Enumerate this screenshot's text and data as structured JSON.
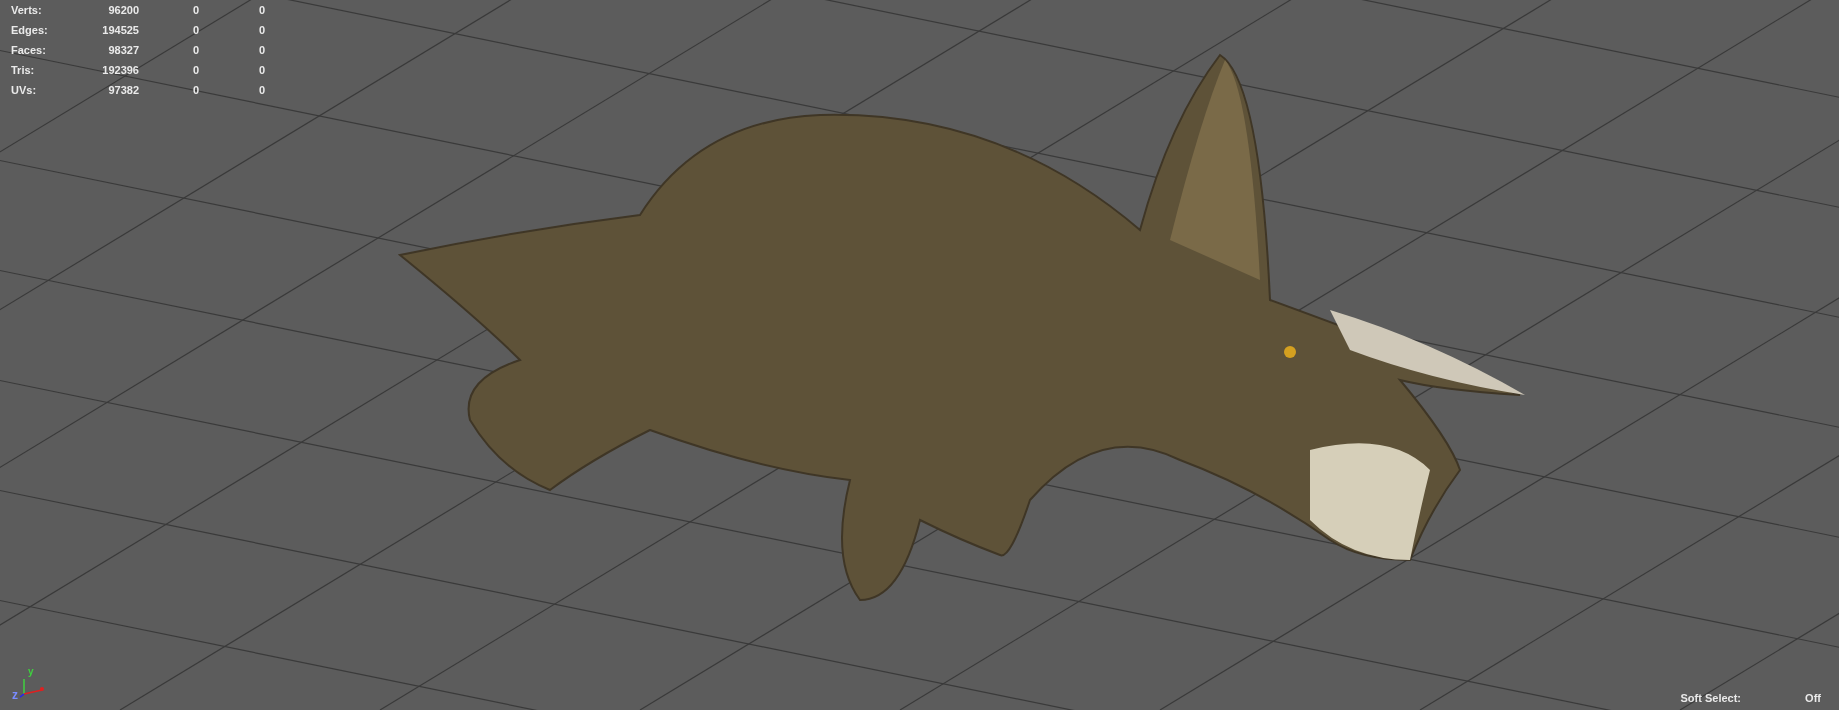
{
  "hud_stats": [
    {
      "label": "Verts:",
      "values": [
        "96200",
        "0",
        "0"
      ]
    },
    {
      "label": "Edges:",
      "values": [
        "194525",
        "0",
        "0"
      ]
    },
    {
      "label": "Faces:",
      "values": [
        "98327",
        "0",
        "0"
      ]
    },
    {
      "label": "Tris:",
      "values": [
        "192396",
        "0",
        "0"
      ]
    },
    {
      "label": "UVs:",
      "values": [
        "97382",
        "0",
        "0"
      ]
    }
  ],
  "axis_gizmo": {
    "y_label": "y",
    "z_label": "z"
  },
  "soft_select": {
    "label": "Soft Select:",
    "value": "Off"
  }
}
